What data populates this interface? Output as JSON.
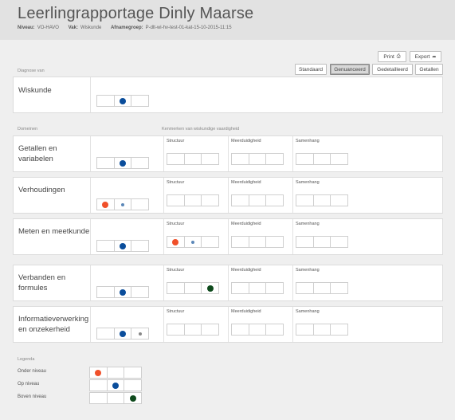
{
  "header": {
    "title": "Leerlingrapportage Dinly Maarse",
    "niveau_label": "Niveau:",
    "niveau_value": "VO-HAVO",
    "vak_label": "Vak:",
    "vak_value": "Wiskunde",
    "afname_label": "Afnamegroep:",
    "afname_value": "P-dlt-wi-hv-test-01-kat-15-10-2015-11:15"
  },
  "toolbar": {
    "print_label": "Print",
    "export_label": "Export",
    "view_buttons": [
      "Standaard",
      "Genuanceerd",
      "Gedetailleerd",
      "Getallen"
    ],
    "active_view": "Genuanceerd"
  },
  "colors": {
    "onder": "#f0502a",
    "op": "#0a4d9b",
    "boven": "#0e4a1c",
    "small_dot": "#5b87b8",
    "small_grey": "#888888"
  },
  "diagnose": {
    "section_label": "Diagnose van",
    "subject": "Wiskunde",
    "level": 1
  },
  "domeinen": {
    "section_label": "Domeinen",
    "kenmerken_label": "Kenmerken van wiskundige vaardigheid",
    "kenmerk_headers": [
      "Structuur",
      "Meerduidigheid",
      "Samenhang"
    ],
    "rows": [
      {
        "name": "Getallen en variabelen",
        "main": {
          "dots": [
            {
              "cell": 1,
              "type": "op"
            }
          ]
        }
      },
      {
        "name": "Verhoudingen",
        "main": {
          "dots": [
            {
              "cell": 0,
              "type": "onder"
            },
            {
              "cell": 1,
              "type": "small_dot"
            }
          ]
        }
      },
      {
        "name": "Meten en meetkunde",
        "main": {
          "dots": [
            {
              "cell": 1,
              "type": "op"
            }
          ]
        },
        "structuur": {
          "dots": [
            {
              "cell": 0,
              "type": "onder"
            },
            {
              "cell": 1,
              "type": "small_dot"
            }
          ]
        }
      },
      {
        "name": "Verbanden en formules",
        "main": {
          "dots": [
            {
              "cell": 1,
              "type": "op"
            }
          ]
        },
        "structuur": {
          "dots": [
            {
              "cell": 2,
              "type": "boven"
            }
          ]
        }
      },
      {
        "name": "Informatieverwerking en onzekerheid",
        "main": {
          "dots": [
            {
              "cell": 1,
              "type": "op"
            },
            {
              "cell": 2,
              "type": "small_grey"
            }
          ]
        }
      }
    ]
  },
  "legenda": {
    "section_label": "Legenda",
    "items": [
      {
        "label": "Onder niveau",
        "cell": 0,
        "type": "onder"
      },
      {
        "label": "Op niveau",
        "cell": 1,
        "type": "op"
      },
      {
        "label": "Boven niveau",
        "cell": 2,
        "type": "boven"
      }
    ]
  }
}
